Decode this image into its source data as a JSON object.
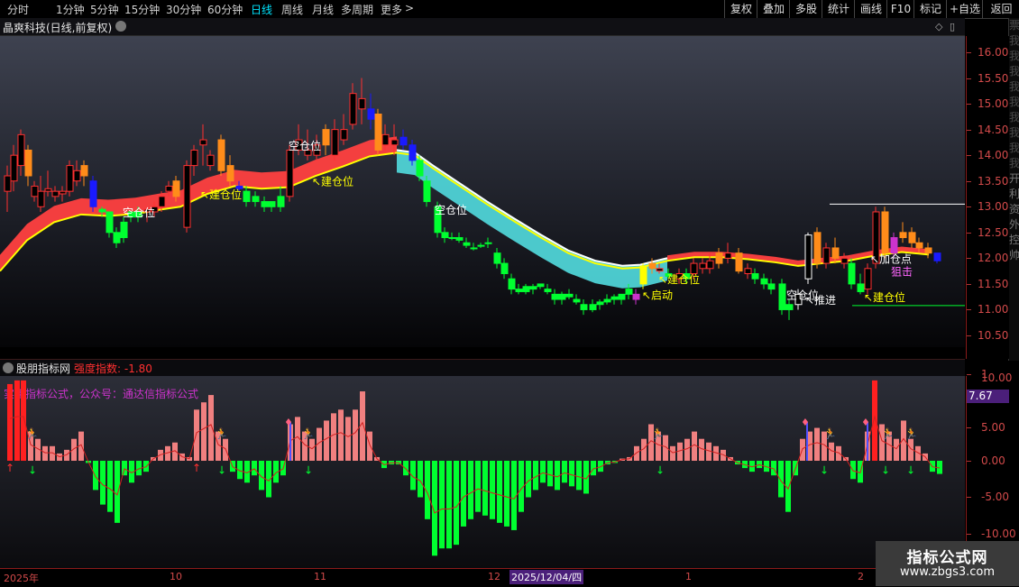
{
  "toolbar": {
    "periods": [
      "分时",
      "1分钟",
      "5分钟",
      "15分钟",
      "30分钟",
      "60分钟",
      "日线",
      "周线",
      "月线",
      "多周期",
      "更多"
    ],
    "active_period": "日线",
    "more_chevron": ">",
    "buttons": [
      "复权",
      "叠加",
      "多股",
      "统计",
      "画线",
      "F10",
      "标记",
      "+自选",
      "返回"
    ]
  },
  "main_panel": {
    "title": "晶爽科技(日线,前复权)",
    "y_ticks": [
      "16.00",
      "15.50",
      "15.00",
      "14.50",
      "14.00",
      "13.50",
      "13.00",
      "12.50",
      "12.00",
      "11.50",
      "11.00",
      "10.50"
    ],
    "right_panel_chars": [
      "票",
      "我",
      "我",
      "我",
      "我",
      "我",
      "我",
      "我",
      "我",
      "我",
      "开",
      "利",
      "资",
      "外",
      "控",
      "帅"
    ],
    "annotations": [
      {
        "text": "空仓位",
        "color": "#ffffff",
        "k": "kc1"
      },
      {
        "text": "↖建仓位",
        "color": "#ffff00",
        "k": "jc1"
      },
      {
        "text": "空仓位",
        "color": "#ffffff",
        "k": "kc2"
      },
      {
        "text": "↖建仓位",
        "color": "#ffff00",
        "k": "jc2"
      },
      {
        "text": "空仓位",
        "color": "#ffffff",
        "k": "kc3"
      },
      {
        "text": "↖启动",
        "color": "#ffff00",
        "k": "qd"
      },
      {
        "text": "↖建仓位",
        "color": "#ffff00",
        "k": "jc3"
      },
      {
        "text": "空仓位",
        "color": "#ffffff",
        "k": "kc4"
      },
      {
        "text": "↖推进",
        "color": "#ffffff",
        "k": "tj"
      },
      {
        "text": "↖加仓点",
        "color": "#ffffff",
        "k": "jcd"
      },
      {
        "text": "狙击",
        "color": "#ff66ff",
        "k": "jj"
      },
      {
        "text": "↖建仓位",
        "color": "#ffff00",
        "k": "jc4"
      }
    ]
  },
  "indicator_panel": {
    "name": "股朋指标网",
    "index_label": "强度指数: -1.80",
    "watermark_text": "实用指标公式，公众号：通达信指标公式",
    "y_ticks": [
      "10.00",
      "5.00",
      "0.00",
      "-5.00",
      "-10.00"
    ],
    "highlight_value": "7.67"
  },
  "x_axis": {
    "labels": [
      "2025年",
      "10",
      "11",
      "12",
      "1",
      "2"
    ],
    "cursor_label": "2025/12/04/四"
  },
  "site_watermark": {
    "line1": "指标公式网",
    "line2": "www.zbgs3.com"
  },
  "colors": {
    "up": "#ff3030",
    "down": "#00ff30",
    "accent": "#00e5ff",
    "axis": "#d24a4a",
    "orange": "#ff8c1a",
    "white": "#ffffff",
    "blue": "#1a1aff",
    "yellow": "#ffff00",
    "cyan_band": "#4fd3d6",
    "red_band": "#ff4040",
    "pink_bar": "#f08080",
    "purple": "#cc33cc"
  },
  "icons": {
    "dropdown": "chevron-down-icon",
    "diamond": "diamond-icon",
    "window": "window-icon",
    "close": "close-icon"
  }
}
